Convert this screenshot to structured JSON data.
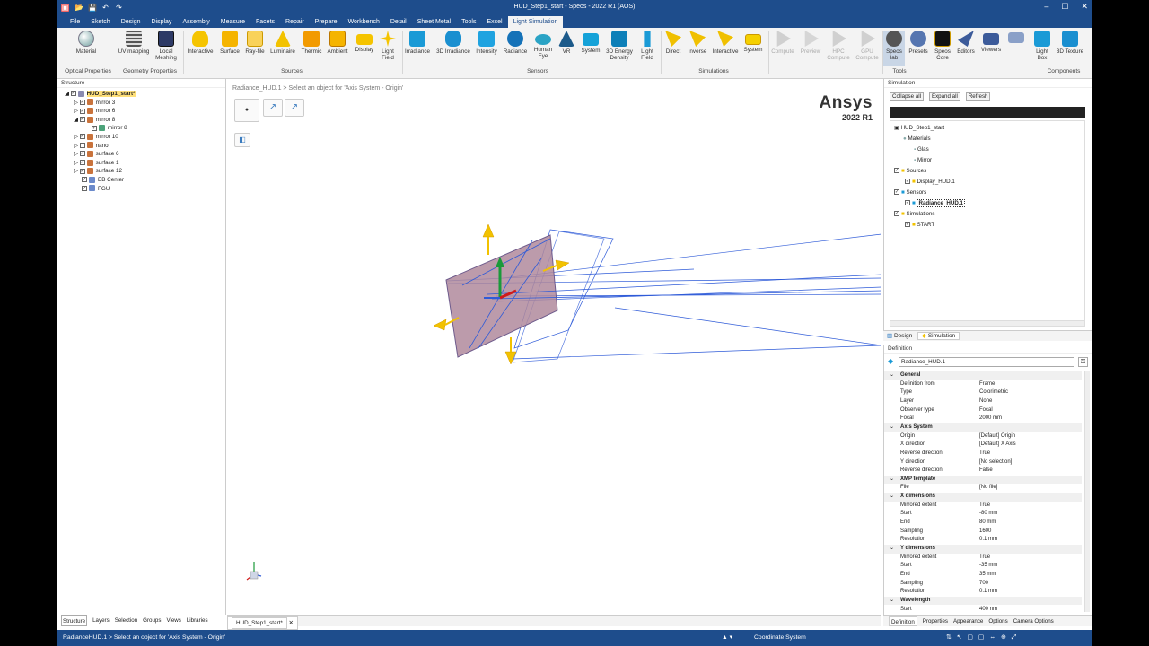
{
  "window": {
    "title": "HUD_Step1_start - Speos - 2022 R1 (AOS)",
    "controls": [
      "–",
      "☐",
      "✕"
    ]
  },
  "menu_tabs": [
    "File",
    "Sketch",
    "Design",
    "Display",
    "Assembly",
    "Measure",
    "Facets",
    "Repair",
    "Prepare",
    "Workbench",
    "Detail",
    "Sheet Metal",
    "Tools",
    "Excel",
    "Light Simulation"
  ],
  "active_tab": "Light Simulation",
  "ribbon": {
    "buttons": {
      "material": "Material",
      "uv_mapping": "UV mapping",
      "local_meshing": "Local Meshing",
      "interactive": "Interactive",
      "surface": "Surface",
      "ray_file": "Ray-file",
      "luminaire": "Luminaire",
      "thermic": "Thermic",
      "ambient": "Ambient",
      "display": "Display",
      "light_field": "Light Field",
      "irradiance": "Irradiance",
      "irradiance_3d": "3D Irradiance",
      "intensity": "Intensity",
      "radiance": "Radiance",
      "human_eye": "Human Eye",
      "vr": "VR",
      "system": "System",
      "energy_density": "3D Energy Density",
      "light_field2": "Light Field",
      "direct": "Direct",
      "inverse": "Inverse",
      "interactive2": "Interactive",
      "system2": "System",
      "compute": "Compute",
      "preview": "Preview",
      "hpc_compute": "HPC Compute",
      "gpu_compute": "GPU Compute",
      "speos_lab": "Speos lab",
      "presets": "Presets",
      "speos_core": "Speos Core",
      "editors": "Editors",
      "viewers": "Viewers",
      "light_box": "Light Box",
      "texture_3d": "3D Texture"
    },
    "groups": {
      "optical": "Optical Properties",
      "geometry": "Geometry Properties",
      "sources": "Sources",
      "sensors": "Sensors",
      "simulations": "Simulations",
      "tools": "Tools",
      "components": "Components"
    }
  },
  "structure": {
    "header": "Structure",
    "items": [
      {
        "label": "HUD_Step1_start*",
        "indent": 0,
        "selected": true
      },
      {
        "label": "mirror 3",
        "indent": 1
      },
      {
        "label": "mirror 6",
        "indent": 1
      },
      {
        "label": "mirror 8",
        "indent": 1
      },
      {
        "label": "mirror 8",
        "indent": 2
      },
      {
        "label": "mirror 10",
        "indent": 1
      },
      {
        "label": "nano",
        "indent": 1
      },
      {
        "label": "surface 6",
        "indent": 1
      },
      {
        "label": "surface 1",
        "indent": 1
      },
      {
        "label": "surface 12",
        "indent": 1
      },
      {
        "label": "EB Center",
        "indent": 1
      },
      {
        "label": "FGU",
        "indent": 1
      }
    ],
    "bottom_tabs": [
      "Structure",
      "Layers",
      "Selection",
      "Groups",
      "Views",
      "Libraries"
    ]
  },
  "viewport": {
    "breadcrumb": "Radiance_HUD.1 > Select an object for 'Axis System - Origin'",
    "brand": "Ansys",
    "version": "2022 R1",
    "doc_tab": "HUD_Step1_start*"
  },
  "simulation": {
    "header": "Simulation",
    "buttons": [
      "Collapse all",
      "Expand all",
      "Refresh"
    ],
    "tree": [
      {
        "label": "HUD_Step1_start",
        "x": 0
      },
      {
        "label": "Materials",
        "x": 1
      },
      {
        "label": "Glas",
        "x": 2
      },
      {
        "label": "Mirror",
        "x": 2
      },
      {
        "label": "Sources",
        "x": 1
      },
      {
        "label": "Display_HUD.1",
        "x": 2
      },
      {
        "label": "Sensors",
        "x": 1
      },
      {
        "label": "Radiance_HUD.1",
        "x": 2
      },
      {
        "label": "Simulations",
        "x": 1
      },
      {
        "label": "START",
        "x": 2
      }
    ],
    "panel_tabs": [
      "Design",
      "Simulation"
    ]
  },
  "definition": {
    "header": "Definition",
    "name": "Radiance_HUD.1",
    "rows": [
      {
        "k": "General",
        "sec": true
      },
      {
        "k": "Definition from",
        "v": "Frame"
      },
      {
        "k": "Type",
        "v": "Colorimetric"
      },
      {
        "k": "Layer",
        "v": "None"
      },
      {
        "k": "Observer type",
        "v": "Focal"
      },
      {
        "k": "Focal",
        "v": "2000 mm"
      },
      {
        "k": "Axis System",
        "sec": true
      },
      {
        "k": "Origin",
        "v": "[Default] Origin"
      },
      {
        "k": "X direction",
        "v": "[Default] X Axis"
      },
      {
        "k": "Reverse direction",
        "v": "True"
      },
      {
        "k": "Y direction",
        "v": "[No selection]"
      },
      {
        "k": "Reverse direction",
        "v": "False"
      },
      {
        "k": "XMP template",
        "sec": true
      },
      {
        "k": "File",
        "v": "[No file]"
      },
      {
        "k": "X dimensions",
        "sec": true
      },
      {
        "k": "Mirrored extent",
        "v": "True"
      },
      {
        "k": "Start",
        "v": "-80 mm"
      },
      {
        "k": "End",
        "v": "80 mm"
      },
      {
        "k": "Sampling",
        "v": "1600"
      },
      {
        "k": "Resolution",
        "v": "0.1 mm"
      },
      {
        "k": "Y dimensions",
        "sec": true
      },
      {
        "k": "Mirrored extent",
        "v": "True"
      },
      {
        "k": "Start",
        "v": "-35 mm"
      },
      {
        "k": "End",
        "v": "35 mm"
      },
      {
        "k": "Sampling",
        "v": "700"
      },
      {
        "k": "Resolution",
        "v": "0.1 mm"
      },
      {
        "k": "Wavelength",
        "sec": true
      },
      {
        "k": "Start",
        "v": "400 nm"
      }
    ],
    "bottom_tabs": [
      "Definition",
      "Properties",
      "Appearance",
      "Options",
      "Camera Options"
    ]
  },
  "status": {
    "message": "RadianceHUD.1 > Select an object for 'Axis System - Origin'",
    "coordinate": "Coordinate System"
  },
  "colors": {
    "title_bar": "#1e4d8c",
    "selection": "#ffe07a",
    "sensor_fill": "#b08a9c",
    "arrow": "#f2c200",
    "ray_blue": "#2f5bd8"
  }
}
